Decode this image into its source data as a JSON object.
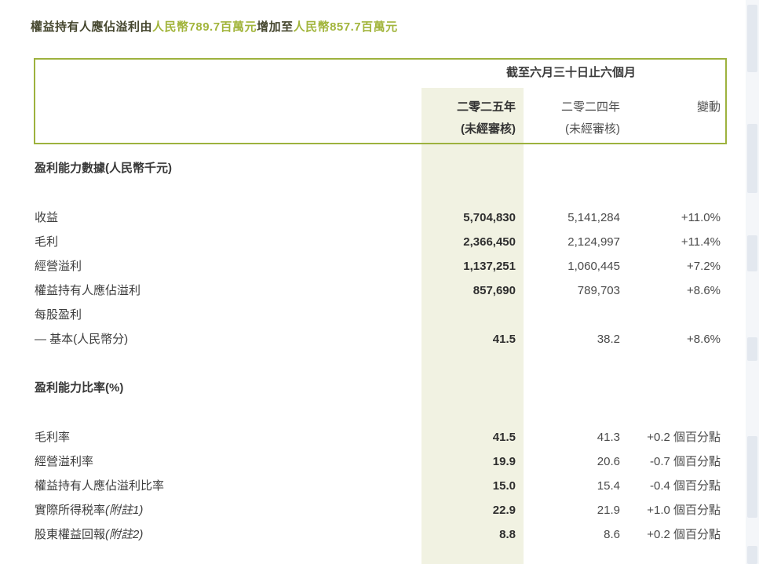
{
  "colors": {
    "title_dark": "#45462e",
    "accent_green": "#a2b53c",
    "border_olive": "#9db23e",
    "highlight_beige": "#f1f2e2"
  },
  "title": {
    "parts": [
      {
        "text": "權益持有人應佔溢利由",
        "tone": "dark"
      },
      {
        "text": "人民幣789.7百萬元",
        "tone": "green"
      },
      {
        "text": "增加至",
        "tone": "dark"
      },
      {
        "text": "人民幣857.7百萬元",
        "tone": "green"
      }
    ]
  },
  "table": {
    "period_header": "截至六月三十日止六個月",
    "columns": [
      {
        "year": "二零二五年",
        "sub": "(未經審核)"
      },
      {
        "year": "二零二四年",
        "sub": "(未經審核)"
      },
      {
        "year": "變動",
        "sub": ""
      }
    ],
    "sections": [
      {
        "heading": "盈利能力數據(人民幣千元)",
        "rows": [
          {
            "label": "收益",
            "note": "",
            "v2025": "5,704,830",
            "v2024": "5,141,284",
            "change": "+11.0%"
          },
          {
            "label": "毛利",
            "note": "",
            "v2025": "2,366,450",
            "v2024": "2,124,997",
            "change": "+11.4%"
          },
          {
            "label": "經營溢利",
            "note": "",
            "v2025": "1,137,251",
            "v2024": "1,060,445",
            "change": "+7.2%"
          },
          {
            "label": "權益持有人應佔溢利",
            "note": "",
            "v2025": "857,690",
            "v2024": "789,703",
            "change": "+8.6%"
          },
          {
            "label": "每股盈利",
            "note": "",
            "v2025": "",
            "v2024": "",
            "change": ""
          },
          {
            "label": "— 基本(人民幣分)",
            "note": "",
            "v2025": "41.5",
            "v2024": "38.2",
            "change": "+8.6%"
          }
        ]
      },
      {
        "heading": "盈利能力比率(%)",
        "rows": [
          {
            "label": "毛利率",
            "note": "",
            "v2025": "41.5",
            "v2024": "41.3",
            "change": "+0.2 個百分點"
          },
          {
            "label": "經營溢利率",
            "note": "",
            "v2025": "19.9",
            "v2024": "20.6",
            "change": "-0.7 個百分點"
          },
          {
            "label": "權益持有人應佔溢利比率",
            "note": "",
            "v2025": "15.0",
            "v2024": "15.4",
            "change": "-0.4 個百分點"
          },
          {
            "label": "實際所得税率",
            "note": "(附註1)",
            "v2025": "22.9",
            "v2024": "21.9",
            "change": "+1.0 個百分點"
          },
          {
            "label": "股東權益回報",
            "note": "(附註2)",
            "v2025": "8.8",
            "v2024": "8.6",
            "change": "+0.2 個百分點"
          }
        ]
      }
    ]
  }
}
